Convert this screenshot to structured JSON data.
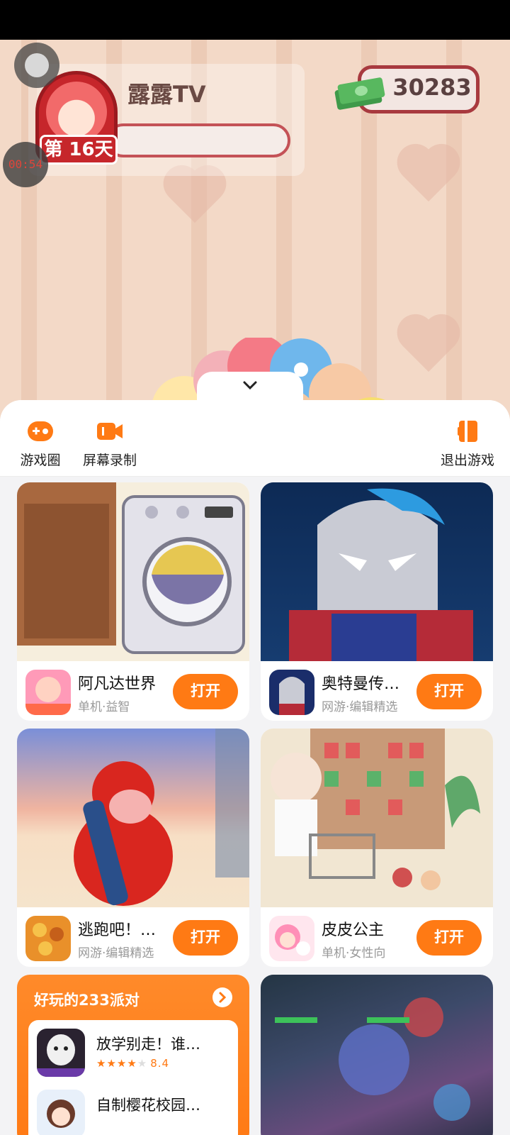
{
  "game": {
    "player_name": "露露TV",
    "day_badge": "第 16天",
    "coins": "30283",
    "timer": "00:54"
  },
  "toolbar": {
    "game_circle": "游戏圈",
    "screen_record": "屏幕录制",
    "exit_game": "退出游戏"
  },
  "cards": [
    {
      "name": "阿凡达世界",
      "meta": "单机·益智",
      "button": "打开"
    },
    {
      "name": "奥特曼传…",
      "meta": "网游·编辑精选",
      "button": "打开"
    },
    {
      "name": "逃跑吧！…",
      "meta": "网游·编辑精选",
      "button": "打开"
    },
    {
      "name": "皮皮公主",
      "meta": "单机·女性向",
      "button": "打开"
    }
  ],
  "party": {
    "title": "好玩的233派对",
    "items": [
      {
        "name": "放学别走！谁…",
        "rating": "8.4",
        "stars": 4
      },
      {
        "name": "自制樱花校园…"
      }
    ]
  },
  "colors": {
    "accent": "#ff7a14",
    "sheet_bg": "#f3f3f5"
  }
}
